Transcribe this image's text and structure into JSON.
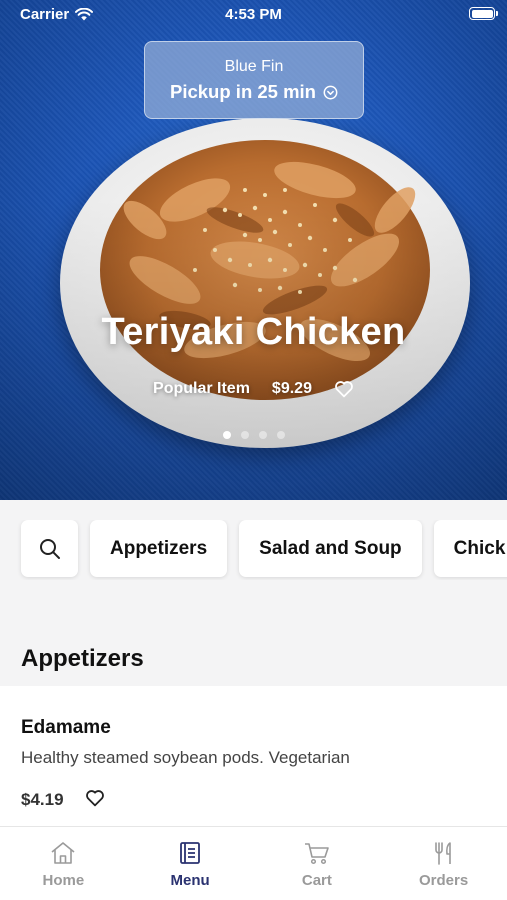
{
  "status_bar": {
    "carrier": "Carrier",
    "time": "4:53 PM"
  },
  "pickup": {
    "store": "Blue Fin",
    "time_label": "Pickup in 25 min"
  },
  "featured": {
    "title": "Teriyaki Chicken",
    "badge": "Popular Item",
    "price": "$9.29",
    "carousel_count": 4,
    "carousel_active": 0
  },
  "categories": [
    "Appetizers",
    "Salad and Soup",
    "Chick"
  ],
  "section": {
    "title": "Appetizers",
    "items": [
      {
        "name": "Edamame",
        "description": "Healthy steamed soybean pods. Vegetarian",
        "price": "$4.19"
      }
    ]
  },
  "tabs": [
    {
      "label": "Home",
      "icon": "home-icon"
    },
    {
      "label": "Menu",
      "icon": "menu-book-icon",
      "active": true
    },
    {
      "label": "Cart",
      "icon": "cart-icon"
    },
    {
      "label": "Orders",
      "icon": "fork-knife-icon"
    }
  ],
  "colors": {
    "active_tab": "#2a3270",
    "inactive_tab": "#9a9a9a",
    "hero_blue": "#1d56b8"
  }
}
